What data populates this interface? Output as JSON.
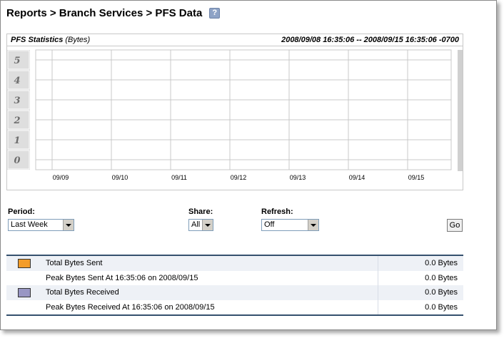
{
  "breadcrumb": {
    "parts": [
      "Reports",
      "Branch Services",
      "PFS Data"
    ],
    "separator": ">",
    "text": "Reports > Branch Services > PFS Data"
  },
  "help_icon_glyph": "?",
  "chart_header": {
    "title": "PFS Statistics",
    "unit": "(Bytes)",
    "range": "2008/09/08 16:35:06 -- 2008/09/15 16:35:06 -0700"
  },
  "chart_data": {
    "type": "line",
    "title": "PFS Statistics",
    "unit": "(Bytes)",
    "y_ticks": [
      "5",
      "4",
      "3",
      "2",
      "1",
      "0"
    ],
    "ylim": [
      0,
      5
    ],
    "x_ticks": [
      "09/09",
      "09/10",
      "09/11",
      "09/12",
      "09/13",
      "09/14",
      "09/15"
    ],
    "grid": true,
    "series": []
  },
  "controls": {
    "period_label": "Period:",
    "period_value": "Last Week",
    "share_label": "Share:",
    "share_value": "All",
    "refresh_label": "Refresh:",
    "refresh_value": "Off",
    "go_label": "Go"
  },
  "legend": [
    {
      "swatch_color": "#f39c29",
      "label": "Total Bytes Sent",
      "value": "0.0 Bytes",
      "shaded": true
    },
    {
      "swatch_color": "",
      "label": "Peak Bytes Sent At 16:35:06 on 2008/09/15",
      "value": "0.0 Bytes",
      "shaded": false
    },
    {
      "swatch_color": "#9896c4",
      "label": "Total Bytes Received",
      "value": "0.0 Bytes",
      "shaded": true
    },
    {
      "swatch_color": "",
      "label": "Peak Bytes Received At 16:35:06 on 2008/09/15",
      "value": "0.0 Bytes",
      "shaded": false
    }
  ],
  "colors": {
    "grid": "#c8c8c8",
    "tick_column": "#d9d9d9",
    "scrollbar": "#d0d0d0",
    "table_border": "#35506e"
  }
}
